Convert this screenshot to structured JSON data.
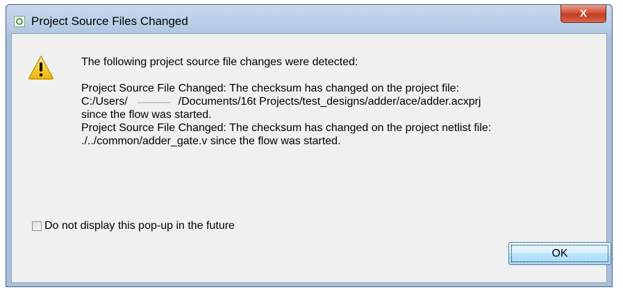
{
  "window": {
    "title": "Project Source Files Changed",
    "close_glyph": "X"
  },
  "message": {
    "header": "The following project source file changes were detected:",
    "change1_line1": "Project Source File Changed:  The checksum has changed on the project file:",
    "change1_path_prefix": "C:/Users/",
    "change1_path_suffix": "/Documents/16t Projects/test_designs/adder/ace/adder.acxprj",
    "change1_line3": "since the flow was started.",
    "change2_line1": "Project Source File Changed:  The checksum has changed on the project netlist file:",
    "change2_line2": "./../common/adder_gate.v since the flow was started."
  },
  "checkbox": {
    "label": "Do not display this pop-up in the future",
    "checked": false
  },
  "buttons": {
    "ok": "OK"
  },
  "icons": {
    "title": "app-icon",
    "warning": "warning-icon"
  }
}
